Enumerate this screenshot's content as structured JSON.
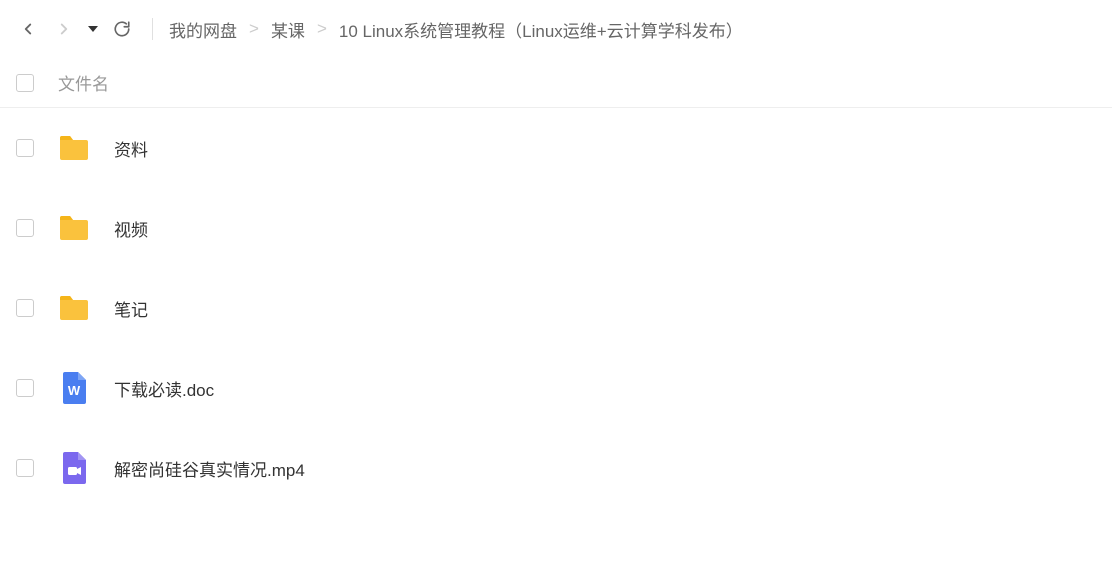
{
  "breadcrumb": {
    "items": [
      "我的网盘",
      "某课",
      "10 Linux系统管理教程（Linux运维+云计算学科发布）"
    ]
  },
  "columns": {
    "name": "文件名"
  },
  "files": [
    {
      "type": "folder",
      "name": "资料"
    },
    {
      "type": "folder",
      "name": "视频"
    },
    {
      "type": "folder",
      "name": "笔记"
    },
    {
      "type": "doc",
      "name": "下载必读.doc"
    },
    {
      "type": "video",
      "name": "解密尚硅谷真实情况.mp4"
    }
  ],
  "colors": {
    "folder": "#FAC23D",
    "folder_tab": "#F5B51A",
    "doc": "#4A7EF0",
    "video": "#7B68EE"
  }
}
